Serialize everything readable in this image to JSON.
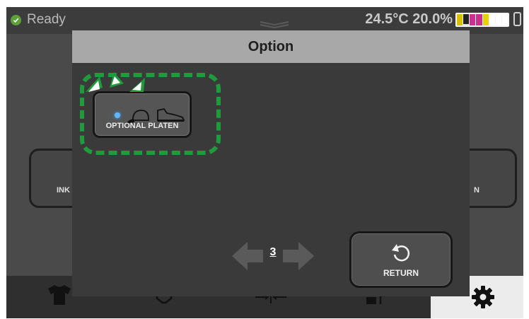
{
  "status": {
    "ready_text": "Ready",
    "temperature": "24.5°C",
    "humidity": "20.0%",
    "ink_levels": [
      {
        "color": "#d8c200",
        "level": 1.0
      },
      {
        "color": "#e0e0e0",
        "level": 0.15
      },
      {
        "color": "#cc2f8e",
        "level": 1.0
      },
      {
        "color": "#cc2f8e",
        "level": 1.0
      },
      {
        "color": "#e8d100",
        "level": 1.0
      },
      {
        "color": "#ffffff",
        "level": 1.0
      },
      {
        "color": "#ffffff",
        "level": 1.0
      },
      {
        "color": "#ffffff",
        "level": 1.0
      }
    ]
  },
  "background": {
    "left_button_text": "INK",
    "right_button_text": "N"
  },
  "modal": {
    "title": "Option",
    "optional_platen_label": "OPTIONAL PLATEN",
    "page_number": "3",
    "return_label": "RETURN"
  },
  "colors": {
    "highlight": "#1f9b3c",
    "led": "#5fb8ff",
    "ready_check": "#5ea13a"
  },
  "icons": [
    "check-icon",
    "chevron-handle-icon",
    "cartridge-icon",
    "cap-icon",
    "shoe-icon",
    "arrow-left-icon",
    "arrow-right-icon",
    "return-icon",
    "tshirt-icon",
    "gear-icon"
  ]
}
